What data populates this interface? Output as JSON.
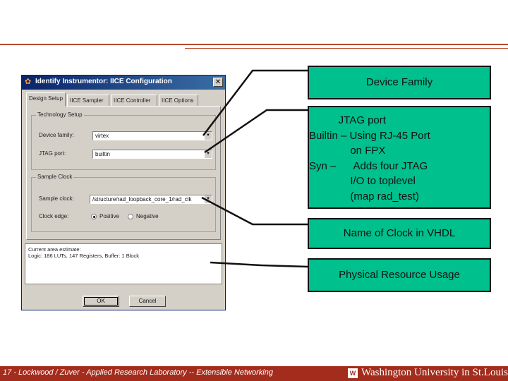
{
  "dialog": {
    "title": "Identify Instrumentor: IICE Configuration",
    "close_glyph": "✕",
    "tabs": [
      "Design Setup",
      "IICE Sampler",
      "IICE Controller",
      "IICE Options"
    ],
    "technology_group": "Technology Setup",
    "device_family_label": "Device family:",
    "device_family_value": "virtex",
    "jtag_port_label": "JTAG port:",
    "jtag_port_value": "builtin",
    "sample_clock_group": "Sample Clock",
    "sample_clock_label": "Sample clock:",
    "sample_clock_value": "/structure/rad_loopback_core_1/rad_clk",
    "clock_edge_label": "Clock edge:",
    "clock_edge_positive": "Positive",
    "clock_edge_negative": "Negative",
    "usage_line1": "Current area estimate:",
    "usage_line2": "Logic: 186 LUTs, 147 Registers, Buffer: 1 Block",
    "ok_label": "OK",
    "cancel_label": "Cancel"
  },
  "callouts": {
    "device_family": "Device Family",
    "jtag": [
      "          JTAG port",
      "Builtin – Using RJ-45 Port",
      "              on FPX",
      "Syn –      Adds four JTAG",
      "              I/O to toplevel",
      "              (map rad_test)"
    ],
    "clock": "Name of Clock in VHDL",
    "resource": "Physical Resource Usage"
  },
  "footer": {
    "text": "17 - Lockwood / Zuver - Applied Research Laboratory -- Extensible Networking",
    "logo_glyph": "W",
    "university": "Washington University in St.Louis"
  },
  "colors": {
    "callout_bg": "#00c08d",
    "footer_bg": "#a42c1c",
    "rule": "#b7472a"
  }
}
